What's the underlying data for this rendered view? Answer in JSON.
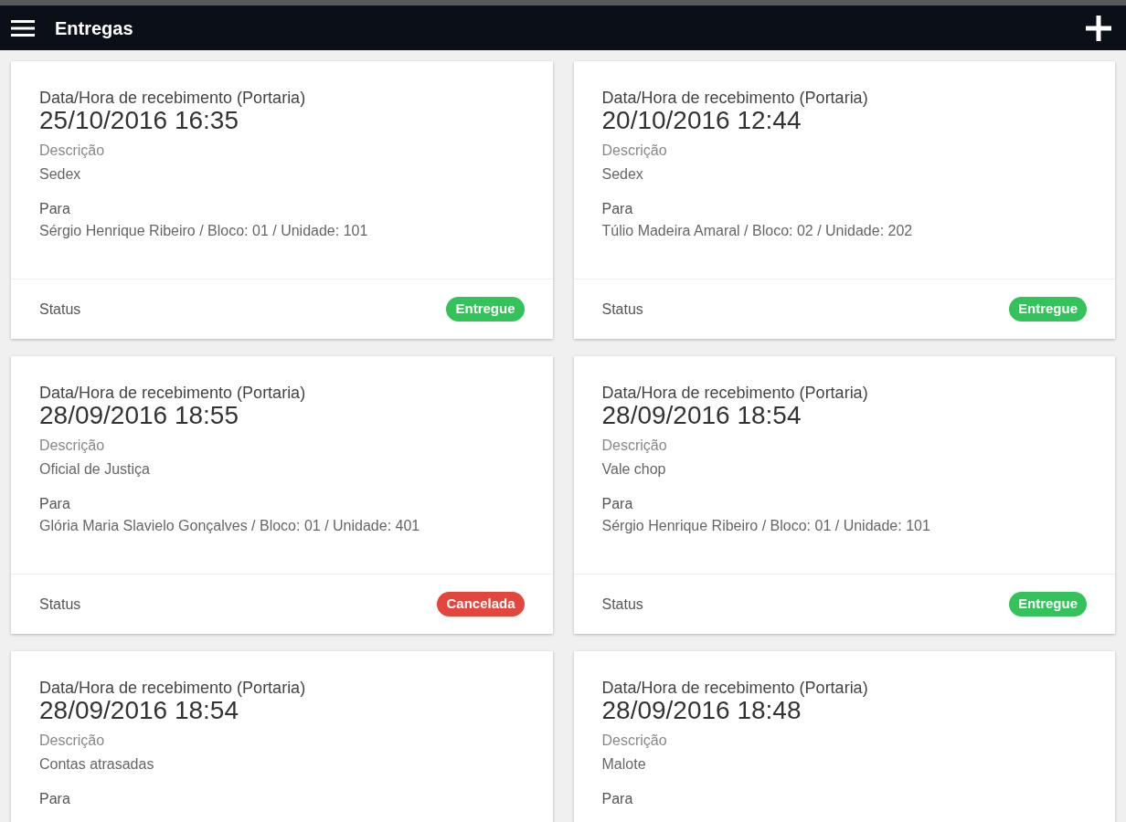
{
  "app_bar": {
    "title": "Entregas"
  },
  "deliveries": [
    {
      "received_label": "Data/Hora de recebimento (Portaria)",
      "received_at": "25/10/2016 16:35",
      "description_label": "Descrição",
      "description": "Sedex",
      "to_label": "Para",
      "to": "Sérgio Henrique Ribeiro / Bloco: 01 / Unidade: 101",
      "status_label": "Status",
      "status": {
        "text": "Entregue",
        "color": "#34c35a"
      }
    },
    {
      "received_label": "Data/Hora de recebimento (Portaria)",
      "received_at": "20/10/2016 12:44",
      "description_label": "Descrição",
      "description": "Sedex",
      "to_label": "Para",
      "to": "Túlio Madeira Amaral / Bloco: 02 / Unidade: 202",
      "status_label": "Status",
      "status": {
        "text": "Entregue",
        "color": "#34c35a"
      }
    },
    {
      "received_label": "Data/Hora de recebimento (Portaria)",
      "received_at": "28/09/2016 18:55",
      "description_label": "Descrição",
      "description": "Oficial de Justiça",
      "to_label": "Para",
      "to": "Glória Maria Slavielo Gonçalves / Bloco: 01 / Unidade: 401",
      "status_label": "Status",
      "status": {
        "text": "Cancelada",
        "color": "#e2463c"
      }
    },
    {
      "received_label": "Data/Hora de recebimento (Portaria)",
      "received_at": "28/09/2016 18:54",
      "description_label": "Descrição",
      "description": "Vale chop",
      "to_label": "Para",
      "to": "Sérgio Henrique Ribeiro / Bloco: 01 / Unidade: 101",
      "status_label": "Status",
      "status": {
        "text": "Entregue",
        "color": "#34c35a"
      }
    },
    {
      "received_label": "Data/Hora de recebimento (Portaria)",
      "received_at": "28/09/2016 18:54",
      "description_label": "Descrição",
      "description": "Contas atrasadas",
      "to_label": "Para"
    },
    {
      "received_label": "Data/Hora de recebimento (Portaria)",
      "received_at": "28/09/2016 18:48",
      "description_label": "Descrição",
      "description": "Malote",
      "to_label": "Para"
    }
  ]
}
